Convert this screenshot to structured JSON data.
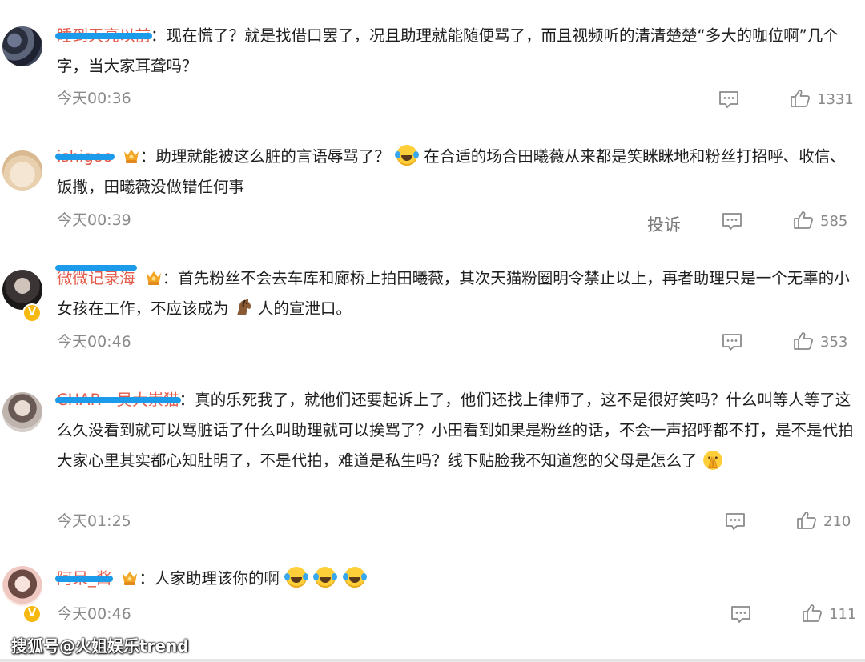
{
  "comments": [
    {
      "username": "睡到天亮以前",
      "medal": false,
      "verified": false,
      "text": "现在慌了？就是找借口罢了，况且助理就能随便骂了，而且视频听的清清楚楚“多大的咖位啊”几个字，当大家耳聋吗？",
      "time": "今天00:36",
      "likes": "1331"
    },
    {
      "username": "ishigoo",
      "medal": true,
      "verified": false,
      "text_before": "助理就能被这么脏的言语辱骂了？",
      "text_after": "在合适的场合田曦薇从来都是笑眯眯地和粉丝打招呼、收信、饭撒，田曦薇没做错任何事",
      "time": "今天00:39",
      "report": "投诉",
      "likes": "585"
    },
    {
      "username": "微微记录海",
      "medal": true,
      "verified": true,
      "text_before": "首先粉丝不会去车库和廊桥上拍田曦薇，其次天猫粉圈明令禁止以上，再者助理只是一个无辜的小女孩在工作，不应该成为",
      "text_after": "人的宣泄口。",
      "time": "今天00:46",
      "likes": "353"
    },
    {
      "username": "CHAR—吴大崇猫",
      "medal": false,
      "verified": false,
      "text": "真的乐死我了，就他们还要起诉上了，他们还找上律师了，这不是很好笑吗？什么叫等人等了这么久没看到就可以骂脏话了什么叫助理就可以挨骂了？小田看到如果是粉丝的话，不会一声招呼都不打，是不是代拍大家心里其实都心知肚明了，不是代拍，难道是私生吗？线下贴脸我不知道您的父母是怎么了",
      "time": "今天01:25",
      "likes": "210"
    },
    {
      "username": "阿呆_酱",
      "medal": true,
      "verified": true,
      "text": "人家助理该你的啊",
      "time": "今天00:46",
      "likes": "111"
    }
  ],
  "separator": "：",
  "watermark": "搜狐号@火姐娱乐trend",
  "icons": [
    "reply-icon",
    "like-icon",
    "medal-icon",
    "laugh-cry-emoji",
    "horse-emoji",
    "pray-emoji",
    "verified-badge-icon"
  ],
  "colors": {
    "username": "#e25b4a",
    "mask": "#1c9bea",
    "meta": "#8a8a8a",
    "badge": "#f6b911"
  }
}
